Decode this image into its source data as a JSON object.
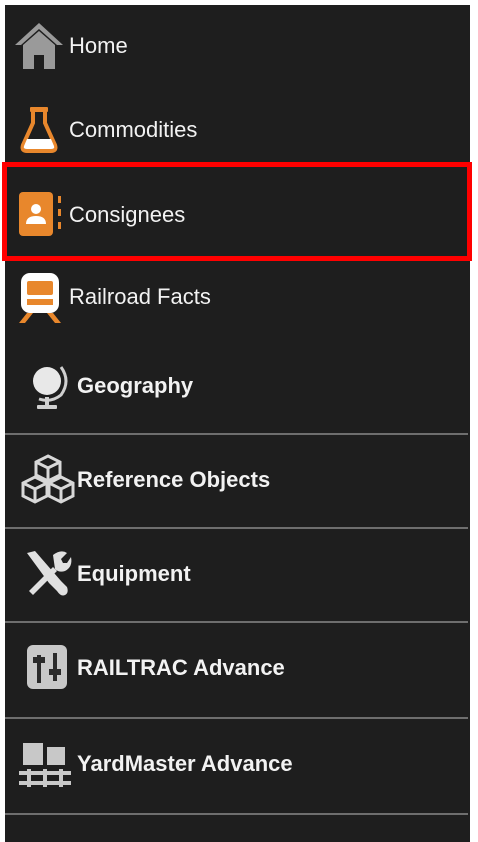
{
  "nav": {
    "items": [
      {
        "label": "Home",
        "icon": "home-icon"
      },
      {
        "label": "Commodities",
        "icon": "flask-icon"
      },
      {
        "label": "Consignees",
        "icon": "contact-book-icon",
        "highlighted": true
      },
      {
        "label": "Railroad Facts",
        "icon": "train-icon"
      }
    ],
    "groups": [
      {
        "label": "Geography",
        "icon": "globe-icon",
        "expandable": true
      },
      {
        "label": "Reference Objects",
        "icon": "boxes-icon",
        "expandable": true
      },
      {
        "label": "Equipment",
        "icon": "tools-icon",
        "expandable": true
      },
      {
        "label": "RAILTRAC Advance",
        "icon": "sliders-icon",
        "expandable": true
      },
      {
        "label": "YardMaster Advance",
        "icon": "yard-icon",
        "expandable": true
      }
    ]
  },
  "colors": {
    "background": "#1e1e1e",
    "text": "#f2f2f2",
    "accent_orange": "#e8872c",
    "highlight_border": "#ff0000",
    "divider": "#6e6e6e"
  }
}
